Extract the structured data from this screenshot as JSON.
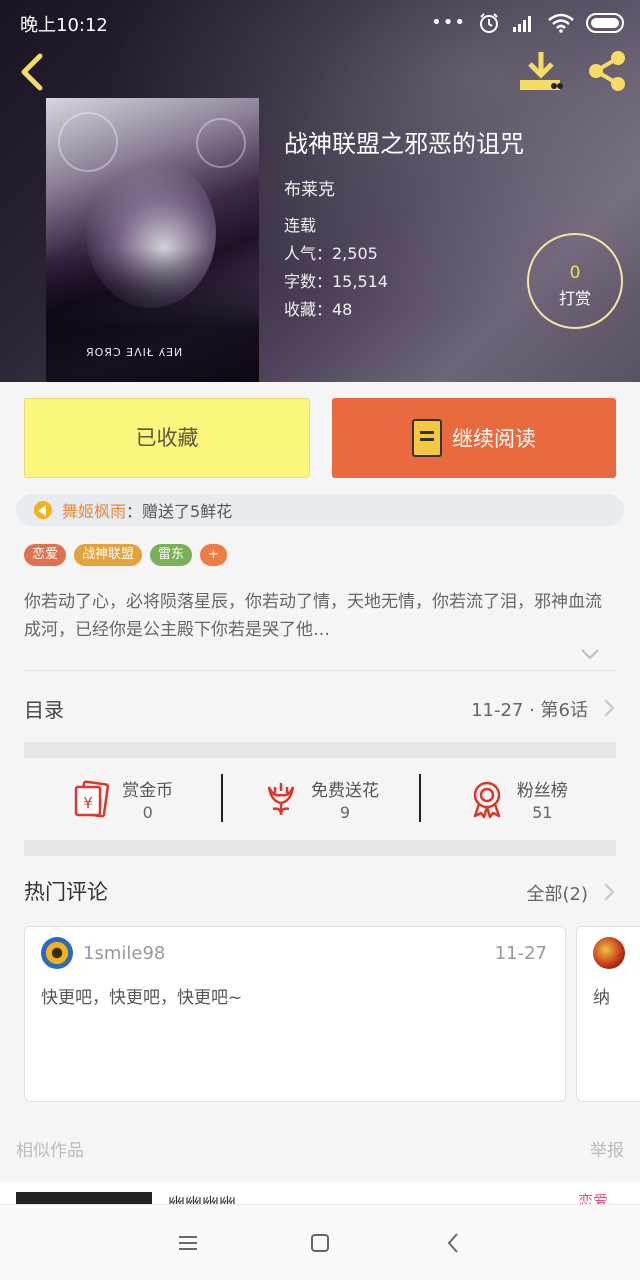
{
  "status_bar": {
    "time": "晚上10:12",
    "dots": "•••"
  },
  "book": {
    "title": "战神联盟之邪恶的诅咒",
    "author": "布莱克",
    "status": "连载",
    "popularity": "人气：2,505",
    "word_count": "字数：15,514",
    "favorites": "收藏：48",
    "cover_caption": "ЯOЯƆ ƎΛIŁ ʎƎИ"
  },
  "tip": {
    "count": "0",
    "label": "打赏"
  },
  "actions": {
    "favorite_label": "已收藏",
    "read_label": "继续阅读"
  },
  "gift": {
    "user": "舞姬枫雨",
    "text": "：赠送了5鲜花"
  },
  "tags": [
    {
      "label": "恋爱",
      "color": "#e0714f"
    },
    {
      "label": "战神联盟",
      "color": "#e3a23c"
    },
    {
      "label": "雷东",
      "color": "#7bb05a"
    },
    {
      "label": "+",
      "color": "#ef7b45"
    }
  ],
  "description": "你若动了心，必将陨落星辰，你若动了情，天地无情，你若流了泪，邪神血流成河，已经你是公主殿下你若是哭了他…",
  "toc": {
    "label": "目录",
    "date": "11-27 · 第6话"
  },
  "stats": [
    {
      "label": "赏金币",
      "value": "0",
      "icon": "red-envelope-icon"
    },
    {
      "label": "免费送花",
      "value": "9",
      "icon": "flower-icon"
    },
    {
      "label": "粉丝榜",
      "value": "51",
      "icon": "medal-icon"
    }
  ],
  "hot_comments": {
    "title": "热门评论",
    "all_label": "全部(2)",
    "items": [
      {
        "user": "1smile98",
        "date": "11-27",
        "text": "快更吧，快更吧，快更吧~"
      },
      {
        "text": "纳"
      }
    ]
  },
  "similar": {
    "label": "相似作品",
    "report": "举报"
  },
  "peek": {
    "title": "幽幽幽幽",
    "tag": "恋爱"
  },
  "colors": {
    "accent_orange": "#e86a3e",
    "fav_yellow": "#fbf77c",
    "icon_yellow": "#f5dc64",
    "stat_red": "#d9382a"
  }
}
